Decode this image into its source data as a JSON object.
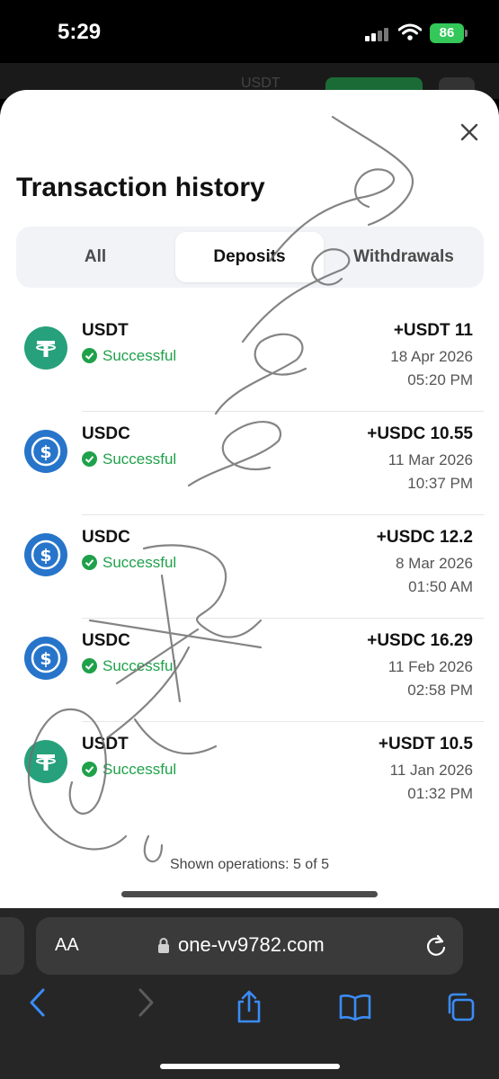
{
  "status_bar": {
    "time": "5:29",
    "battery": "86"
  },
  "background_app": {
    "currency": "USDT"
  },
  "sheet": {
    "title": "Transaction history",
    "tabs": [
      {
        "label": "All",
        "active": false
      },
      {
        "label": "Deposits",
        "active": true
      },
      {
        "label": "Withdrawals",
        "active": false
      }
    ],
    "transactions": [
      {
        "coin": "USDT",
        "icon": "tether-icon",
        "status": "Successful",
        "amount": "+USDT 11",
        "date": "18 Apr 2026",
        "time": "05:20 PM"
      },
      {
        "coin": "USDC",
        "icon": "usd-coin-icon",
        "status": "Successful",
        "amount": "+USDC 10.55",
        "date": "11 Mar 2026",
        "time": "10:37 PM"
      },
      {
        "coin": "USDC",
        "icon": "usd-coin-icon",
        "status": "Successful",
        "amount": "+USDC 12.2",
        "date": "8 Mar 2026",
        "time": "01:50 AM"
      },
      {
        "coin": "USDC",
        "icon": "usd-coin-icon",
        "status": "Successful",
        "amount": "+USDC 16.29",
        "date": "11 Feb 2026",
        "time": "02:58 PM"
      },
      {
        "coin": "USDT",
        "icon": "tether-icon",
        "status": "Successful",
        "amount": "+USDT 10.5",
        "date": "11 Jan 2026",
        "time": "01:32 PM"
      }
    ],
    "footer": "Shown operations: 5 of 5"
  },
  "browser": {
    "aa_label": "AA",
    "url": "one-vv9782.com",
    "toolbar_icons": [
      "back-icon",
      "forward-icon",
      "share-icon",
      "bookmarks-icon",
      "tabs-icon"
    ]
  },
  "watermark": "@Htsmaew",
  "colors": {
    "success": "#1fa14a",
    "usdt": "#26a17b",
    "usdc": "#2775ca",
    "battery": "#34c759"
  }
}
